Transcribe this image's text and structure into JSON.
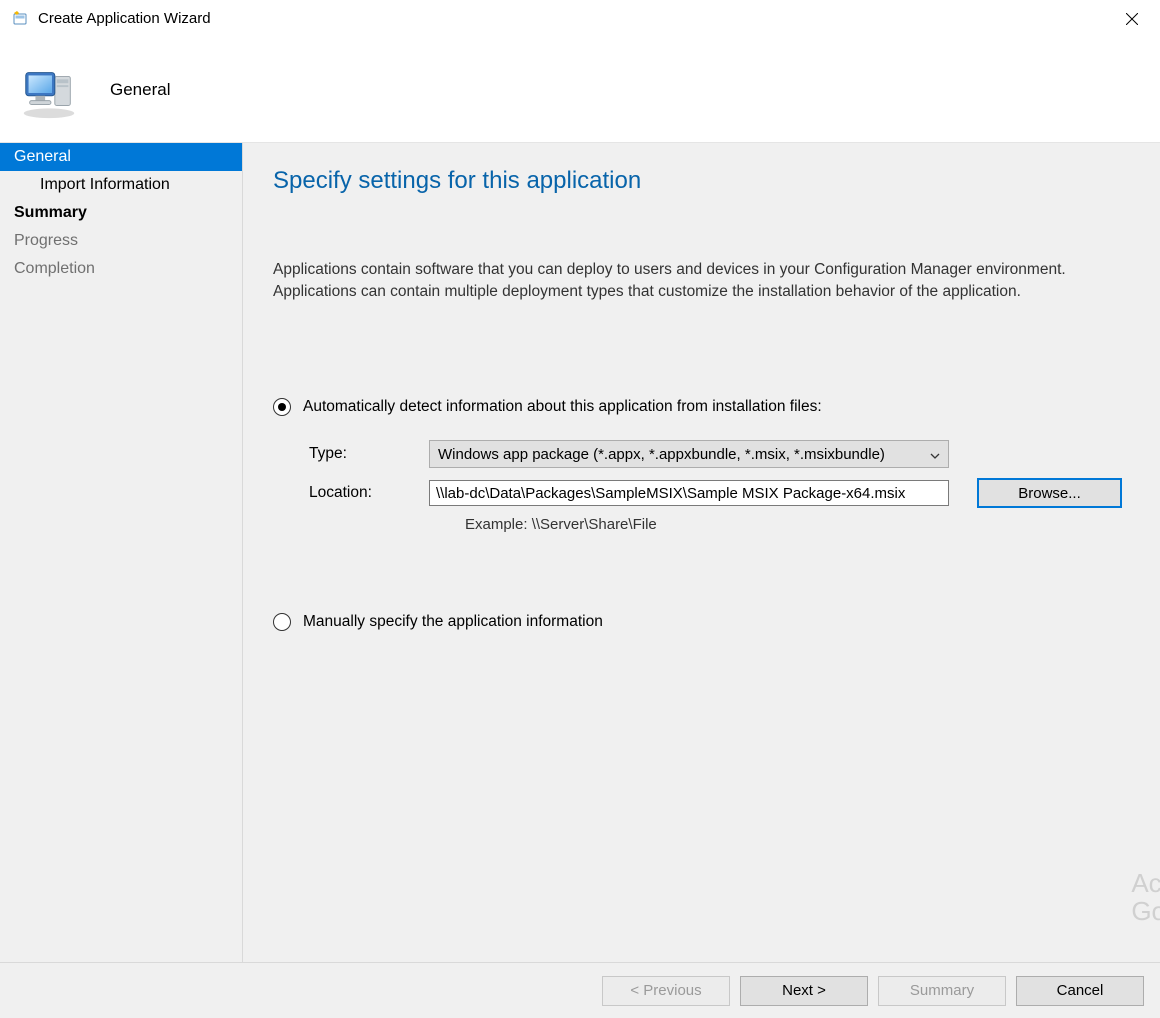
{
  "window": {
    "title": "Create Application Wizard"
  },
  "header": {
    "page_title": "General"
  },
  "sidebar": {
    "steps": [
      "General",
      "Import Information",
      "Summary",
      "Progress",
      "Completion"
    ]
  },
  "content": {
    "heading": "Specify settings for this application",
    "description": "Applications contain software that you can deploy to users and devices in your Configuration Manager environment. Applications can contain multiple deployment types that customize the installation behavior of the application.",
    "radio_auto": "Automatically detect information about this application from installation files:",
    "radio_manual": "Manually specify the application information",
    "type_label": "Type:",
    "type_value": "Windows app package (*.appx, *.appxbundle, *.msix, *.msixbundle)",
    "location_label": "Location:",
    "location_value": "\\\\lab-dc\\Data\\Packages\\SampleMSIX\\Sample MSIX Package-x64.msix",
    "location_example": "Example: \\\\Server\\Share\\File",
    "browse_label": "Browse..."
  },
  "footer": {
    "previous": "< Previous",
    "next": "Next >",
    "summary": "Summary",
    "cancel": "Cancel"
  },
  "ghost": {
    "line1": "Ac",
    "line2": "Go"
  }
}
